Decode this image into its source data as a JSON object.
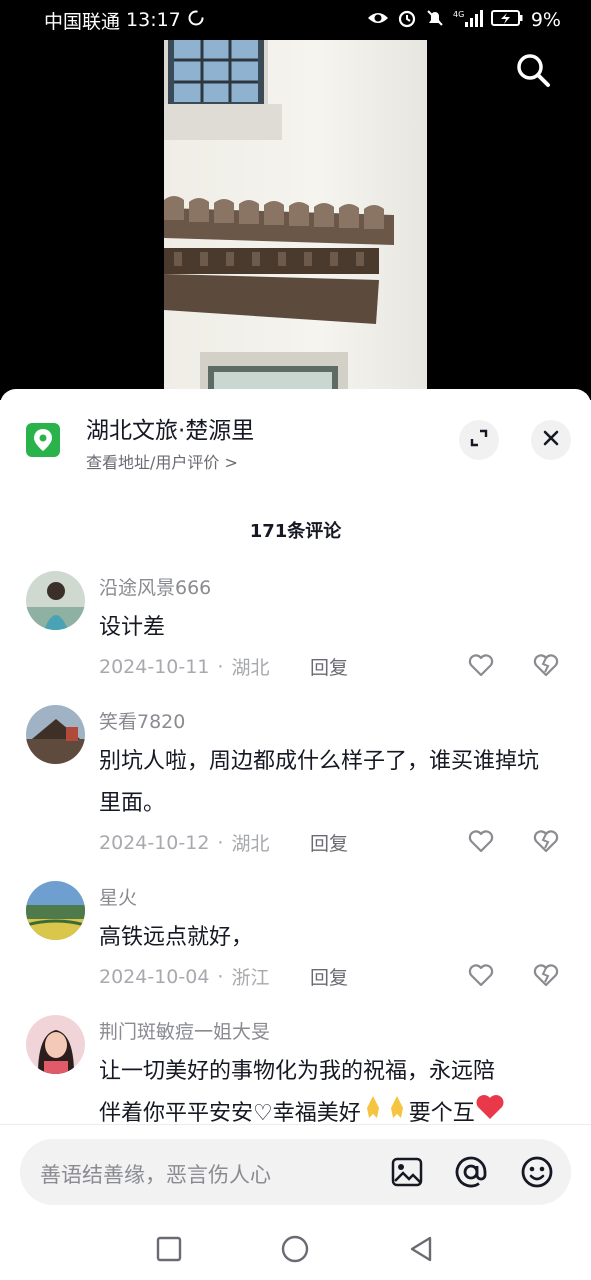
{
  "status_bar": {
    "carrier": "中国联通",
    "time": "13:17",
    "network": "4G",
    "battery": "9%"
  },
  "location": {
    "title": "湖北文旅·楚源里",
    "subtitle": "查看地址/用户评价 >"
  },
  "comment_count": "171条评论",
  "comments": [
    {
      "user": "沿途风景666",
      "text": "设计差",
      "date": "2024-10-11",
      "region": "湖北",
      "reply": "回复"
    },
    {
      "user": "笑看7820",
      "text": "别坑人啦，周边都成什么样子了，谁买谁掉坑里面。",
      "date": "2024-10-12",
      "region": "湖北",
      "reply": "回复"
    },
    {
      "user": "星火",
      "text": "高铁远点就好，",
      "date": "2024-10-04",
      "region": "浙江",
      "reply": "回复"
    },
    {
      "user": "荆门斑敏痘一姐大旻",
      "text_line1": "让一切美好的事物化为我的祝福，永远陪",
      "text_line2a": "伴着你平平安安♡幸福美好",
      "text_line2b": "要个互"
    }
  ],
  "input": {
    "placeholder": "善语结善缘，恶言伤人心"
  },
  "icons": {
    "search": "search-icon",
    "location": "location-pin-icon",
    "expand": "expand-icon",
    "close": "close-icon",
    "like": "heart-icon",
    "dislike": "broken-heart-icon",
    "image": "image-icon",
    "mention": "at-icon",
    "emoji": "emoji-icon"
  },
  "colors": {
    "accent_green": "#2ab34a",
    "heart_red": "#e8384a"
  }
}
